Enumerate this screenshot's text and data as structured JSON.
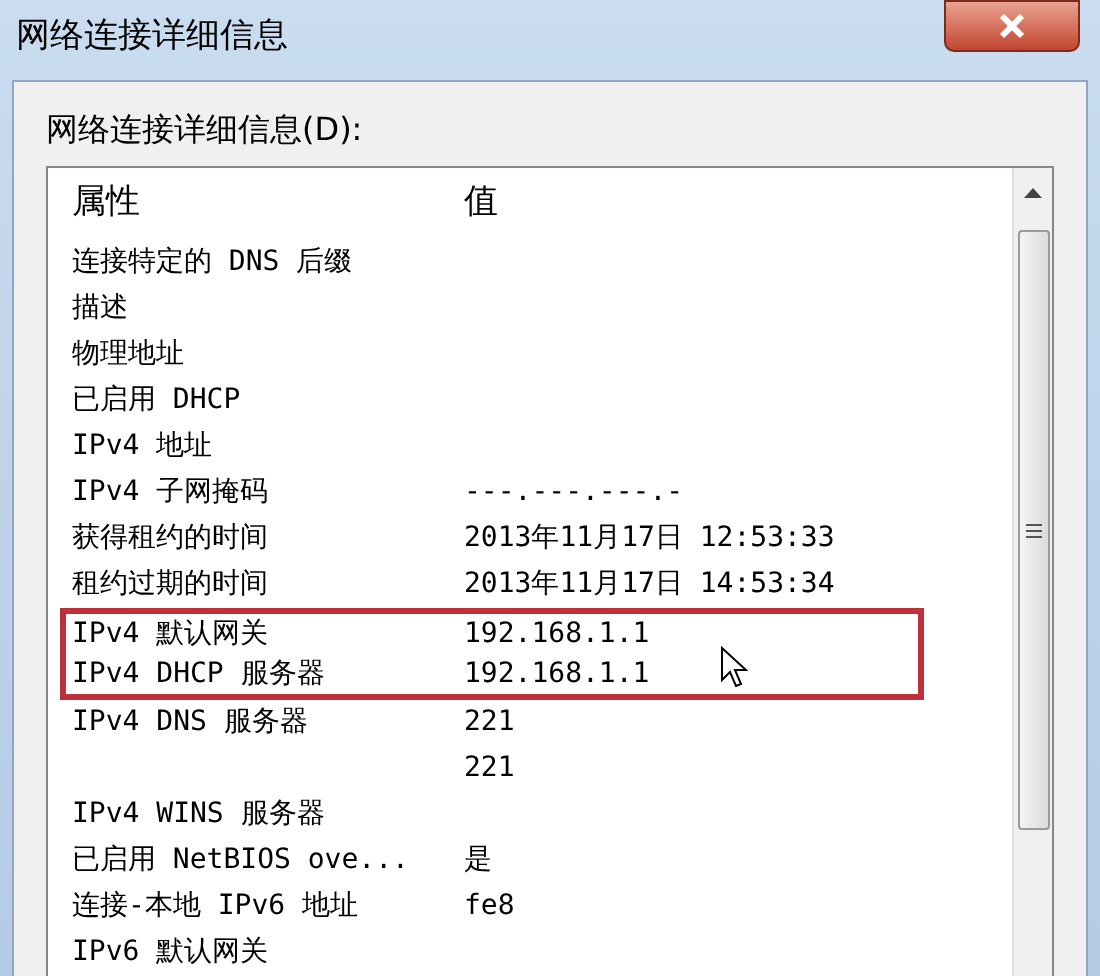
{
  "window": {
    "title": "网络连接详细信息"
  },
  "list_label": "网络连接详细信息(D):",
  "table": {
    "columns": [
      "属性",
      "值"
    ],
    "rows": [
      {
        "property": "连接特定的 DNS 后缀",
        "value": "",
        "highlighted": false
      },
      {
        "property": "描述",
        "value": "",
        "highlighted": false
      },
      {
        "property": "物理地址",
        "value": "",
        "highlighted": false
      },
      {
        "property": "已启用 DHCP",
        "value": "",
        "highlighted": false
      },
      {
        "property": "IPv4 地址",
        "value": "",
        "highlighted": false
      },
      {
        "property": "IPv4 子网掩码",
        "value": "---.---.---.-",
        "highlighted": false
      },
      {
        "property": "获得租约的时间",
        "value": "2013年11月17日 12:53:33",
        "highlighted": false
      },
      {
        "property": "租约过期的时间",
        "value": "2013年11月17日 14:53:34",
        "highlighted": false
      },
      {
        "property": "IPv4 默认网关",
        "value": "192.168.1.1",
        "highlighted": true
      },
      {
        "property": "IPv4 DHCP 服务器",
        "value": "192.168.1.1",
        "highlighted": true
      },
      {
        "property": "IPv4 DNS 服务器",
        "value": "221",
        "highlighted": false
      },
      {
        "property": "",
        "value": "221",
        "highlighted": false
      },
      {
        "property": "IPv4 WINS 服务器",
        "value": "",
        "highlighted": false
      },
      {
        "property": "已启用 NetBIOS ove...",
        "value": "是",
        "highlighted": false
      },
      {
        "property": "连接-本地 IPv6 地址",
        "value": "fe8",
        "highlighted": false
      },
      {
        "property": "IPv6 默认网关",
        "value": "",
        "highlighted": false
      }
    ]
  }
}
